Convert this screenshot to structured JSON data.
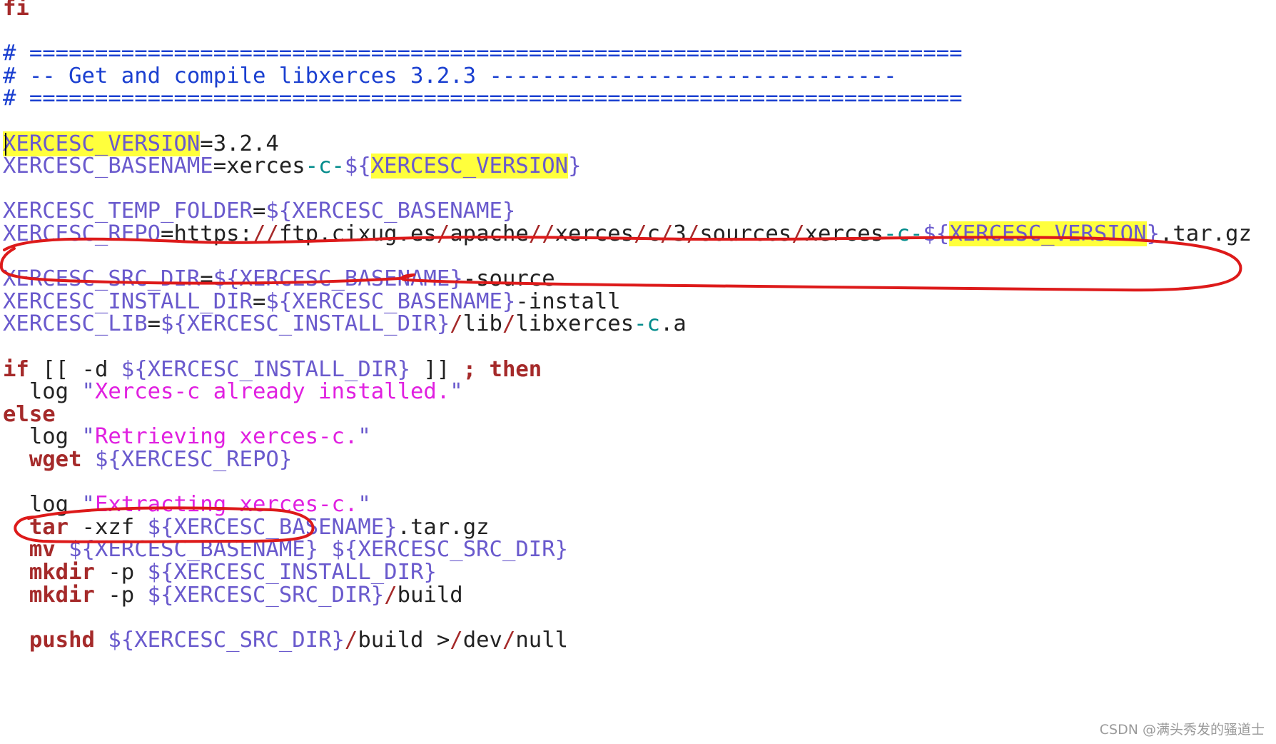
{
  "colors": {
    "keyword": "#a52a2a",
    "comment": "#1a3fd0",
    "variable": "#6a5acd",
    "string": "#e020e0",
    "operator": "#008b8b",
    "plain": "#222222",
    "highlight": "#ffff3c",
    "annotation": "#dd1a1a"
  },
  "editor": {
    "lines": [
      [
        {
          "t": "fi",
          "c": "keyword",
          "b": true
        }
      ],
      [],
      [
        {
          "t": "# =======================================================================",
          "c": "comment"
        }
      ],
      [
        {
          "t": "# -- Get and compile libxerces 3.2.3 -------------------------------",
          "c": "comment"
        }
      ],
      [
        {
          "t": "# =======================================================================",
          "c": "comment"
        }
      ],
      [],
      [
        {
          "t": "XERCESC_VERSION",
          "c": "variable",
          "hl": true
        },
        {
          "t": "=3.2.4",
          "c": "plain"
        }
      ],
      [
        {
          "t": "XERCESC_BASENAME",
          "c": "variable"
        },
        {
          "t": "=xerces",
          "c": "plain"
        },
        {
          "t": "-c-",
          "c": "operator"
        },
        {
          "t": "${",
          "c": "variable"
        },
        {
          "t": "XERCESC_VERSION",
          "c": "variable",
          "hl": true
        },
        {
          "t": "}",
          "c": "variable"
        }
      ],
      [],
      [
        {
          "t": "XERCESC_TEMP_FOLDER",
          "c": "variable"
        },
        {
          "t": "=",
          "c": "plain"
        },
        {
          "t": "${XERCESC_BASENAME}",
          "c": "variable"
        }
      ],
      [
        {
          "t": "XERCESC_REPO",
          "c": "variable"
        },
        {
          "t": "=https:",
          "c": "plain"
        },
        {
          "t": "//",
          "c": "keyword"
        },
        {
          "t": "ftp.cixug.es",
          "c": "plain"
        },
        {
          "t": "/",
          "c": "keyword"
        },
        {
          "t": "apache",
          "c": "plain"
        },
        {
          "t": "//",
          "c": "keyword"
        },
        {
          "t": "xerces",
          "c": "plain"
        },
        {
          "t": "/",
          "c": "keyword"
        },
        {
          "t": "c",
          "c": "plain"
        },
        {
          "t": "/",
          "c": "keyword"
        },
        {
          "t": "3",
          "c": "plain"
        },
        {
          "t": "/",
          "c": "keyword"
        },
        {
          "t": "sources",
          "c": "plain"
        },
        {
          "t": "/",
          "c": "keyword"
        },
        {
          "t": "xerces",
          "c": "plain"
        },
        {
          "t": "-c-",
          "c": "operator"
        },
        {
          "t": "${",
          "c": "variable"
        },
        {
          "t": "XERCESC_VERSION",
          "c": "variable",
          "hl": true
        },
        {
          "t": "}",
          "c": "variable"
        },
        {
          "t": ".tar.gz",
          "c": "plain"
        }
      ],
      [],
      [
        {
          "t": "XERCESC_SRC_DIR",
          "c": "variable"
        },
        {
          "t": "=",
          "c": "plain"
        },
        {
          "t": "${XERCESC_BASENAME}",
          "c": "variable"
        },
        {
          "t": "-source",
          "c": "plain"
        }
      ],
      [
        {
          "t": "XERCESC_INSTALL_DIR",
          "c": "variable"
        },
        {
          "t": "=",
          "c": "plain"
        },
        {
          "t": "${XERCESC_BASENAME}",
          "c": "variable"
        },
        {
          "t": "-install",
          "c": "plain"
        }
      ],
      [
        {
          "t": "XERCESC_LIB",
          "c": "variable"
        },
        {
          "t": "=",
          "c": "plain"
        },
        {
          "t": "${XERCESC_INSTALL_DIR}",
          "c": "variable"
        },
        {
          "t": "/",
          "c": "keyword"
        },
        {
          "t": "lib",
          "c": "plain"
        },
        {
          "t": "/",
          "c": "keyword"
        },
        {
          "t": "libxerces",
          "c": "plain"
        },
        {
          "t": "-c",
          "c": "operator"
        },
        {
          "t": ".a",
          "c": "plain"
        }
      ],
      [],
      [
        {
          "t": "if",
          "c": "keyword",
          "b": true
        },
        {
          "t": " [[ -d ",
          "c": "plain"
        },
        {
          "t": "${XERCESC_INSTALL_DIR}",
          "c": "variable"
        },
        {
          "t": " ]] ",
          "c": "plain"
        },
        {
          "t": "; then",
          "c": "keyword",
          "b": true
        }
      ],
      [
        {
          "t": "  log ",
          "c": "plain"
        },
        {
          "t": "\"",
          "c": "variable"
        },
        {
          "t": "Xerces-c already installed.",
          "c": "string"
        },
        {
          "t": "\"",
          "c": "variable"
        }
      ],
      [
        {
          "t": "else",
          "c": "keyword",
          "b": true
        }
      ],
      [
        {
          "t": "  log ",
          "c": "plain"
        },
        {
          "t": "\"",
          "c": "variable"
        },
        {
          "t": "Retrieving xerces-c.",
          "c": "string"
        },
        {
          "t": "\"",
          "c": "variable"
        }
      ],
      [
        {
          "t": "  ",
          "c": "plain"
        },
        {
          "t": "wget",
          "c": "keyword",
          "b": true
        },
        {
          "t": " ",
          "c": "plain"
        },
        {
          "t": "${XERCESC_REPO}",
          "c": "variable"
        }
      ],
      [],
      [
        {
          "t": "  log ",
          "c": "plain"
        },
        {
          "t": "\"",
          "c": "variable"
        },
        {
          "t": "Extracting xerces-c.",
          "c": "string"
        },
        {
          "t": "\"",
          "c": "variable"
        }
      ],
      [
        {
          "t": "  ",
          "c": "plain"
        },
        {
          "t": "tar",
          "c": "keyword",
          "b": true
        },
        {
          "t": " -xzf ",
          "c": "plain"
        },
        {
          "t": "${XERCESC_BASENAME}",
          "c": "variable"
        },
        {
          "t": ".tar.gz",
          "c": "plain"
        }
      ],
      [
        {
          "t": "  ",
          "c": "plain"
        },
        {
          "t": "mv",
          "c": "keyword",
          "b": true
        },
        {
          "t": " ",
          "c": "plain"
        },
        {
          "t": "${XERCESC_BASENAME}",
          "c": "variable"
        },
        {
          "t": " ",
          "c": "plain"
        },
        {
          "t": "${XERCESC_SRC_DIR}",
          "c": "variable"
        }
      ],
      [
        {
          "t": "  ",
          "c": "plain"
        },
        {
          "t": "mkdir",
          "c": "keyword",
          "b": true
        },
        {
          "t": " -p ",
          "c": "plain"
        },
        {
          "t": "${XERCESC_INSTALL_DIR}",
          "c": "variable"
        }
      ],
      [
        {
          "t": "  ",
          "c": "plain"
        },
        {
          "t": "mkdir",
          "c": "keyword",
          "b": true
        },
        {
          "t": " -p ",
          "c": "plain"
        },
        {
          "t": "${XERCESC_SRC_DIR}",
          "c": "variable"
        },
        {
          "t": "/",
          "c": "keyword"
        },
        {
          "t": "build",
          "c": "plain"
        }
      ],
      [],
      [
        {
          "t": "  ",
          "c": "plain"
        },
        {
          "t": "pushd",
          "c": "keyword",
          "b": true
        },
        {
          "t": " ",
          "c": "plain"
        },
        {
          "t": "${XERCESC_SRC_DIR}",
          "c": "variable"
        },
        {
          "t": "/",
          "c": "keyword"
        },
        {
          "t": "build >",
          "c": "plain"
        },
        {
          "t": "/",
          "c": "keyword"
        },
        {
          "t": "dev",
          "c": "plain"
        },
        {
          "t": "/",
          "c": "keyword"
        },
        {
          "t": "null",
          "c": "plain"
        }
      ]
    ]
  },
  "watermark": "CSDN @满头秀发的骚道士"
}
